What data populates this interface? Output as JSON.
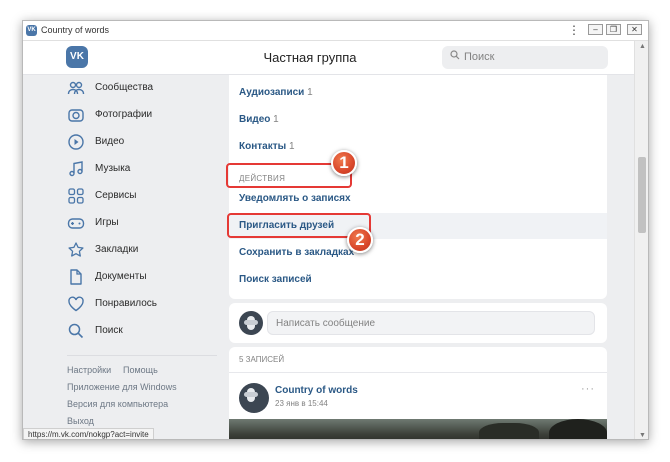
{
  "window": {
    "title": "Country of words",
    "app_icon_text": "VK",
    "menu_dots": "⋮",
    "minimize": "–",
    "restore": "❐",
    "close": "✕"
  },
  "header": {
    "logo_text": "VK",
    "title": "Частная группа",
    "search_placeholder": "Поиск",
    "search_icon": "🔍"
  },
  "sidebar": {
    "items": [
      {
        "label": "Сообщества",
        "icon": "communities-icon"
      },
      {
        "label": "Фотографии",
        "icon": "camera-icon"
      },
      {
        "label": "Видео",
        "icon": "play-icon"
      },
      {
        "label": "Музыка",
        "icon": "music-icon"
      },
      {
        "label": "Сервисы",
        "icon": "services-icon"
      },
      {
        "label": "Игры",
        "icon": "gamepad-icon"
      },
      {
        "label": "Закладки",
        "icon": "star-icon"
      },
      {
        "label": "Документы",
        "icon": "document-icon"
      },
      {
        "label": "Понравилось",
        "icon": "heart-icon"
      },
      {
        "label": "Поиск",
        "icon": "search-icon"
      }
    ],
    "footer": {
      "settings": "Настройки",
      "help": "Помощь",
      "windows_app": "Приложение для Windows",
      "desktop_version": "Версия для компьютера",
      "logout": "Выход"
    }
  },
  "menu": {
    "audio": {
      "label": "Аудиозаписи",
      "count": "1"
    },
    "video": {
      "label": "Видео",
      "count": "1"
    },
    "contacts": {
      "label": "Контакты",
      "count": "1"
    },
    "actions_caption": "ДЕЙСТВИЯ",
    "notify": "Уведомлять о записях",
    "invite": "Пригласить друзей",
    "bookmark": "Сохранить в закладках",
    "search_posts": "Поиск записей"
  },
  "compose": {
    "placeholder": "Написать сообщение"
  },
  "posts": {
    "count_label": "5 ЗАПИСЕЙ",
    "author": "Country of words",
    "date": "23 янв в 15:44",
    "more": "···"
  },
  "status_url": "https://m.vk.com/nokgp?act=invite",
  "annotations": {
    "badge1": "1",
    "badge2": "2",
    "highlight_color": "#e53935"
  },
  "colors": {
    "accent": "#4a76a8",
    "link": "#2a5885",
    "background": "#edeef0"
  },
  "scroll": {
    "up": "▲",
    "down": "▼"
  }
}
